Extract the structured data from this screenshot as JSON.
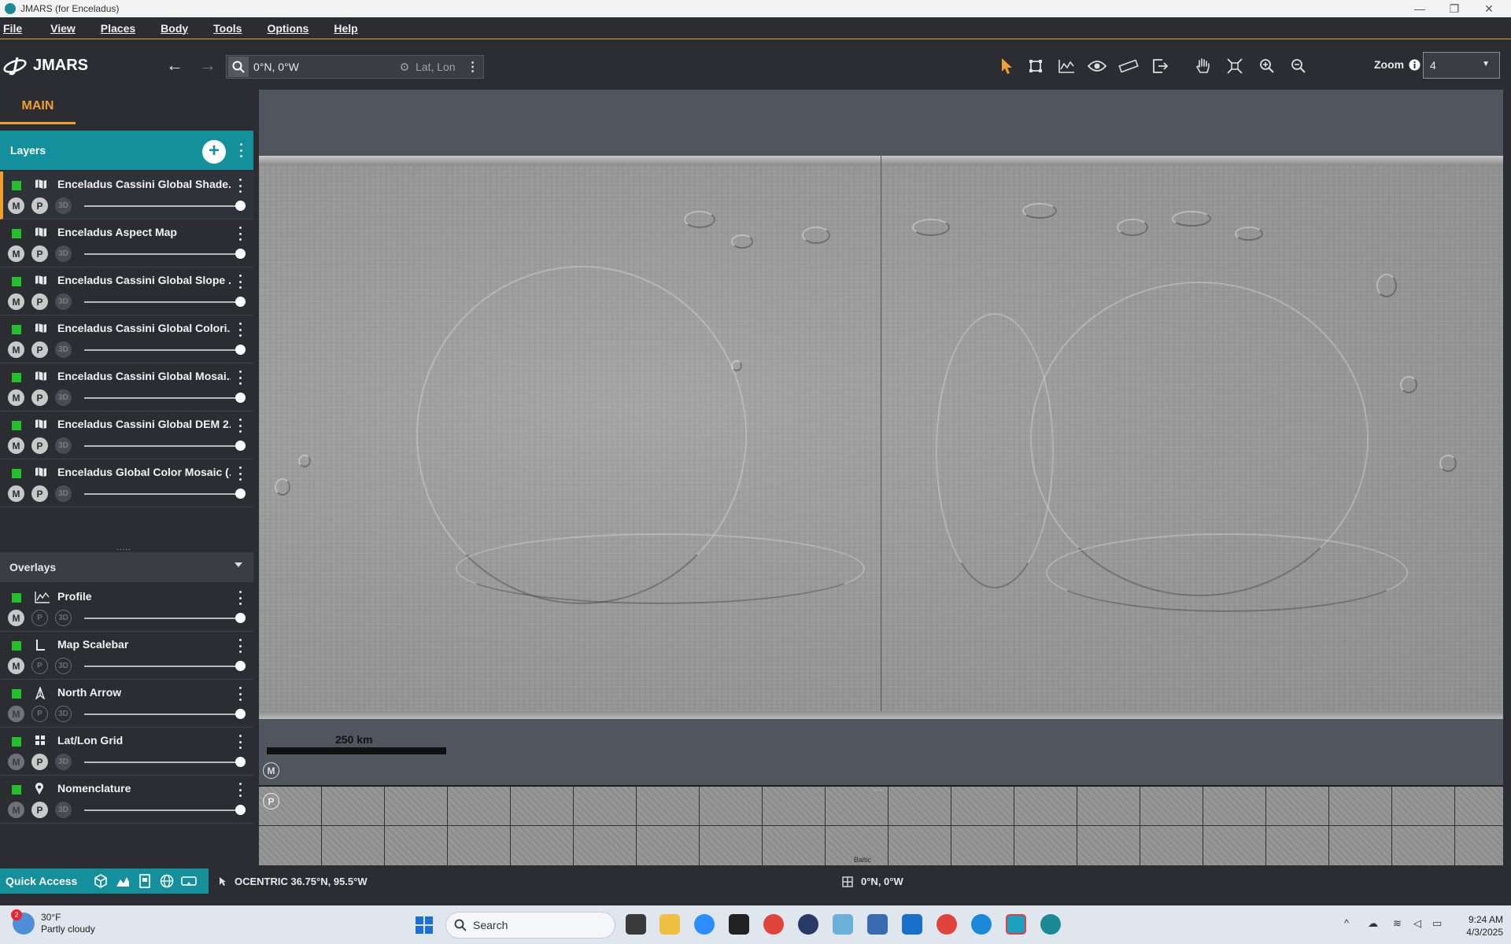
{
  "window": {
    "title": "JMARS (for Enceladus)"
  },
  "menu": [
    "File",
    "View",
    "Places",
    "Body",
    "Tools",
    "Options",
    "Help"
  ],
  "toolbar": {
    "app_name": "JMARS",
    "location_value": "0°N, 0°W",
    "location_mode": "Lat, Lon",
    "zoom_label": "Zoom",
    "zoom_value": "4",
    "tools": [
      "select-arrow-icon",
      "bounding-box-icon",
      "profile-chart-icon",
      "eye-icon",
      "ruler-icon",
      "export-icon",
      "pan-hand-icon",
      "fit-extent-icon",
      "zoom-in-icon",
      "zoom-out-icon"
    ]
  },
  "sidebar": {
    "tab": "MAIN",
    "layers_title": "Layers",
    "layers": [
      {
        "name": "Enceladus Cassini Global Shade...",
        "m": "M",
        "p": "P",
        "d": "3D",
        "selected": true
      },
      {
        "name": "Enceladus Aspect Map",
        "m": "M",
        "p": "P",
        "d": "3D"
      },
      {
        "name": "Enceladus Cassini Global Slope ...",
        "m": "M",
        "p": "P",
        "d": "3D"
      },
      {
        "name": "Enceladus Cassini Global Colori...",
        "m": "M",
        "p": "P",
        "d": "3D"
      },
      {
        "name": "Enceladus Cassini Global Mosai...",
        "m": "M",
        "p": "P",
        "d": "3D"
      },
      {
        "name": "Enceladus Cassini Global DEM 2...",
        "m": "M",
        "p": "P",
        "d": "3D"
      },
      {
        "name": "Enceladus Global Color Mosaic (...",
        "m": "M",
        "p": "P",
        "d": "3D"
      }
    ],
    "overlays_title": "Overlays",
    "overlays": [
      {
        "name": "Profile",
        "icon": "profile-chart-icon",
        "m": "M",
        "p": "P",
        "d": "3D"
      },
      {
        "name": "Map Scalebar",
        "icon": "scalebar-icon",
        "m": "M",
        "p": "P",
        "d": "3D"
      },
      {
        "name": "North Arrow",
        "icon": "north-arrow-icon",
        "m": "M",
        "p": "P",
        "d": "3D"
      },
      {
        "name": "Lat/Lon Grid",
        "icon": "grid-icon",
        "m": "M",
        "p": "P",
        "d": "3D"
      },
      {
        "name": "Nomenclature",
        "icon": "map-pin-icon",
        "m": "M",
        "p": "P",
        "d": "3D"
      }
    ]
  },
  "map": {
    "scalebar_label": "250 km",
    "main_badge": "M",
    "pan_badge": "P",
    "pan_label": "Baltic"
  },
  "status": {
    "quick_access": "Quick Access",
    "cursor_coord": "OCENTRIC 36.75°N, 95.5°W",
    "center_coord": "0°N, 0°W"
  },
  "taskbar": {
    "weather_temp": "30°F",
    "weather_desc": "Partly cloudy",
    "weather_badge": "2",
    "search_placeholder": "Search",
    "time": "9:24 AM",
    "date": "4/3/2025"
  }
}
